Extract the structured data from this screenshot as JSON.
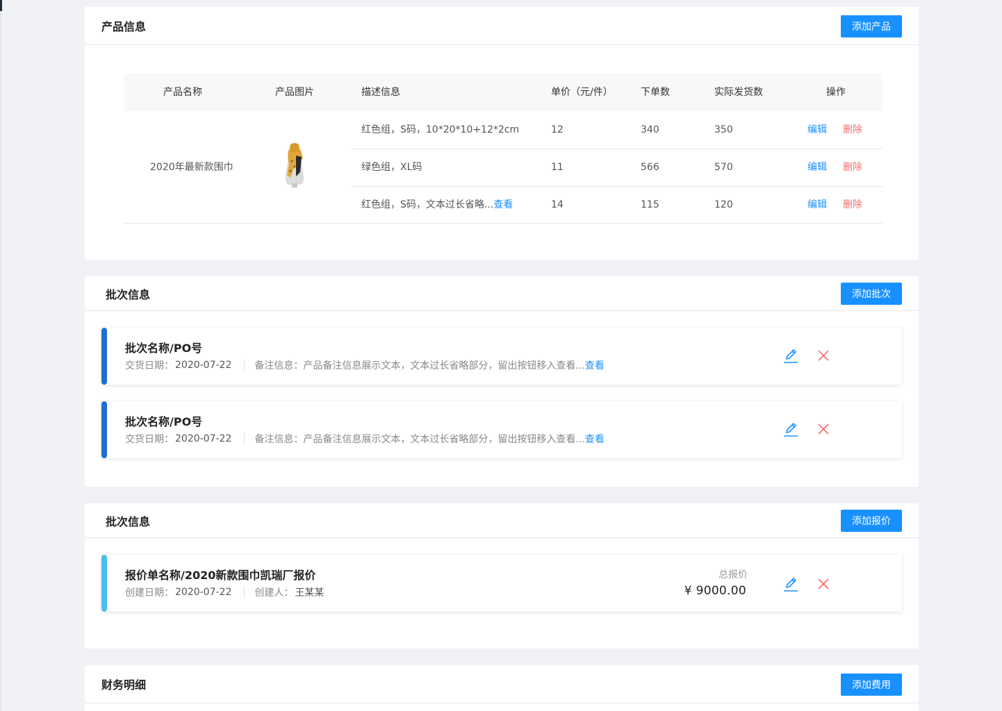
{
  "product_section": {
    "title": "产品信息",
    "add_button": "添加产品",
    "table": {
      "headers": [
        "产品名称",
        "产品图片",
        "描述信息",
        "单价（元/件）",
        "下单数",
        "实际发货数",
        "操作"
      ],
      "product_name": "2020年最新款围巾",
      "rows": [
        {
          "desc": "红色组，S码，10*20*10+12*2cm",
          "desc_link": "",
          "price": "12",
          "ordered": "340",
          "shipped": "350",
          "edit": "编辑",
          "delete": "删除"
        },
        {
          "desc": "绿色组，XL码",
          "desc_link": "",
          "price": "11",
          "ordered": "566",
          "shipped": "570",
          "edit": "编辑",
          "delete": "删除"
        },
        {
          "desc": "红色组，S码，文本过长省略...",
          "desc_link": "查看",
          "price": "14",
          "ordered": "115",
          "shipped": "120",
          "edit": "编辑",
          "delete": "删除"
        }
      ]
    }
  },
  "batch_section": {
    "title": "批次信息",
    "add_button": "添加批次",
    "items": [
      {
        "name": "批次名称/PO号",
        "date_label": "交货日期：",
        "date": "2020-07-22",
        "note_label": "备注信息：",
        "note": "产品备注信息展示文本，文本过长省略部分，留出按钮移入查看...",
        "note_link": "查看"
      },
      {
        "name": "批次名称/PO号",
        "date_label": "交货日期：",
        "date": "2020-07-22",
        "note_label": "备注信息：",
        "note": "产品备注信息展示文本，文本过长省略部分，留出按钮移入查看...",
        "note_link": "查看"
      }
    ]
  },
  "quote_section": {
    "title": "批次信息",
    "add_button": "添加报价",
    "items": [
      {
        "name": "报价单名称/2020新款围巾凯瑞厂报价",
        "date_label": "创建日期：",
        "date": "2020-07-22",
        "creator_label": "创建人：",
        "creator": "王某某",
        "total_label": "总报价",
        "total": "¥ 9000.00"
      }
    ]
  },
  "finance_section": {
    "title": "财务明细",
    "add_button": "添加费用"
  },
  "colors": {
    "primary": "#1890ff",
    "danger": "#f56c6c",
    "batch_bar": "#1f6fd0",
    "quote_bar": "#46c0f0",
    "page_bg": "#f0f2f5"
  },
  "icons": {
    "edit": "pencil-icon",
    "delete": "close-icon"
  }
}
